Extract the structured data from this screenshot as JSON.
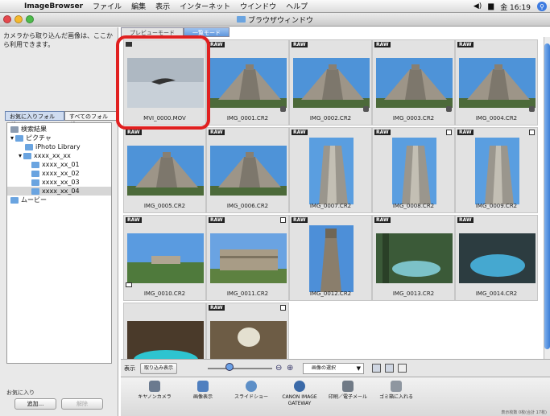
{
  "menubar": {
    "app": "ImageBrowser",
    "items": [
      "ファイル",
      "編集",
      "表示",
      "インターネット",
      "ウインドウ",
      "ヘルプ"
    ],
    "clock": "金 16:19"
  },
  "window": {
    "title": "ブラウザウィンドウ"
  },
  "left": {
    "description": "カメラから取り込んだ画像は、ここから利用できます。",
    "folder_tabs": [
      "お気に入りフォルダ",
      "すべてのフォルダ"
    ],
    "tree": [
      {
        "label": "検索結果"
      },
      {
        "label": "ピクチャ"
      },
      {
        "label": "iPhoto Library"
      },
      {
        "label": "xxxx_xx_xx"
      },
      {
        "label": "xxxx_xx_01"
      },
      {
        "label": "xxxx_xx_02"
      },
      {
        "label": "xxxx_xx_03"
      },
      {
        "label": "xxxx_xx_04"
      },
      {
        "label": "ムービー"
      }
    ],
    "favorites_label": "お気に入り",
    "add_button": "追加...",
    "remove_button": "解除"
  },
  "mode_tabs": [
    "プレビューモード",
    "一覧モード"
  ],
  "thumbnails": [
    {
      "name": "MVI_0000.MOV",
      "badge": "",
      "kind": "bird"
    },
    {
      "name": "IMG_0001.CR2",
      "badge": "RAW",
      "kind": "pyramid"
    },
    {
      "name": "IMG_0002.CR2",
      "badge": "RAW",
      "kind": "pyramid"
    },
    {
      "name": "IMG_0003.CR2",
      "badge": "RAW",
      "kind": "pyramid"
    },
    {
      "name": "IMG_0004.CR2",
      "badge": "RAW",
      "kind": "pyramid"
    },
    {
      "name": "IMG_0005.CR2",
      "badge": "RAW",
      "kind": "pyramid"
    },
    {
      "name": "IMG_0006.CR2",
      "badge": "RAW",
      "kind": "pyramid"
    },
    {
      "name": "IMG_0007.CR2",
      "badge": "RAW",
      "kind": "stairs"
    },
    {
      "name": "IMG_0008.CR2",
      "badge": "RAW",
      "kind": "stairs"
    },
    {
      "name": "IMG_0009.CR2",
      "badge": "RAW",
      "kind": "stairs"
    },
    {
      "name": "IMG_0010.CR2",
      "badge": "RAW",
      "kind": "ruins"
    },
    {
      "name": "IMG_0011.CR2",
      "badge": "RAW",
      "kind": "ruins2"
    },
    {
      "name": "IMG_0012.CR2",
      "badge": "RAW",
      "kind": "monument"
    },
    {
      "name": "IMG_0013.CR2",
      "badge": "RAW",
      "kind": "cenote"
    },
    {
      "name": "IMG_0014.CR2",
      "badge": "RAW",
      "kind": "cenote2"
    },
    {
      "name": "",
      "badge": "",
      "kind": "cave"
    },
    {
      "name": "",
      "badge": "RAW",
      "kind": "cave2"
    }
  ],
  "viewbar": {
    "label": "表示",
    "import_button": "取り込み表示",
    "select_label": "画像の選択"
  },
  "actions": [
    {
      "label": "キヤノンカメラ",
      "icon": "camera-icon"
    },
    {
      "label": "画像表示",
      "icon": "image-view-icon"
    },
    {
      "label": "スライドショー",
      "icon": "slideshow-icon"
    },
    {
      "label": "CANON IMAGE GATEWAY",
      "icon": "gateway-icon"
    },
    {
      "label": "印刷／電子メール",
      "icon": "print-icon"
    },
    {
      "label": "ゴミ箱に入れる",
      "icon": "trash-icon"
    }
  ],
  "status": "表示枚数 0枚(合計 17枚)",
  "colors": {
    "selection_highlight": "#e02020",
    "accent": "#3e7fd6"
  }
}
